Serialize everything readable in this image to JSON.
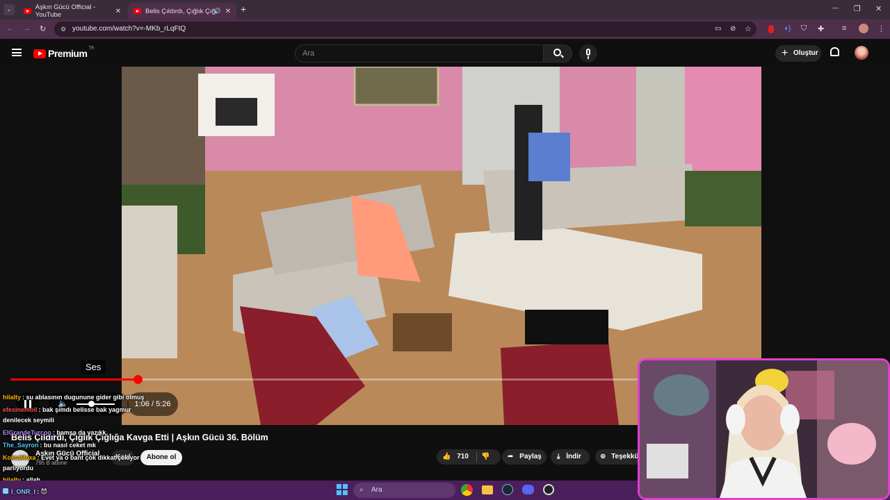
{
  "browser": {
    "tabs": [
      {
        "title": "Aşkın Gücü Official - YouTube",
        "close": "✕"
      },
      {
        "title": "Belis Çıldırdı, Çığlık Çığlığa K",
        "close": "✕"
      }
    ],
    "new_tab": "+",
    "window_controls": {
      "minimize": "—",
      "maximize": "❐",
      "close": "✕"
    },
    "url": "youtube.com/watch?v=-MKb_rLqFtQ"
  },
  "youtube": {
    "logo_text": "Premium",
    "logo_badge": "TR",
    "search_placeholder": "Ara",
    "create_label": "Oluştur"
  },
  "player": {
    "tooltip": "Ses",
    "time": "1:06 / 5:26",
    "progress": 0.203
  },
  "video_info": {
    "title": "Belis Çıldırdı, Çığlık Çığlığa Kavga Etti | Aşkın Gücü 36. Bölüm",
    "channel": "Aşkın Gücü Official",
    "subscribers": "795 B abone",
    "join_label": "Katıl",
    "subscribe_label": "Abone ol",
    "likes": "710",
    "share_label": "Paylaş",
    "download_label": "İndir",
    "thanks_label": "Teşekkür"
  },
  "chat": [
    {
      "user": "hilalty",
      "color": "#ffb300",
      "text": ": su ablasının dugunune gider gibi olmuş"
    },
    {
      "user": "efesinemoil",
      "color": "#ff4d4d",
      "text": ": bak şımdı belisse bak yagmur"
    },
    {
      "user": "",
      "color": "#ffffff",
      "text": "denilecek seymili"
    },
    {
      "user": "ElGrandeTurcoo",
      "color": "#b388ff",
      "text": ": bamsa da yazıkk"
    },
    {
      "user": "The_Sayron",
      "color": "#4fc3f7",
      "text": ": bu nasıl ceket mk"
    },
    {
      "user": "KomaMexa",
      "color": "#ffb300",
      "text": ": Evet ya o bant çok dikkat çekiyor"
    },
    {
      "user": "",
      "color": "#ffffff",
      "text": "parlıyordu"
    },
    {
      "user": "hilalty",
      "color": "#ffb300",
      "text": ": allah"
    },
    {
      "user": "I_ONR_I",
      "color": "#7fd1ff",
      "text": ": 😈"
    }
  ],
  "taskbar": {
    "search_placeholder": "Ara"
  },
  "colors": {
    "tab_strip": "#3a2d3a",
    "address_bar": "#4d2f4a",
    "youtube_red": "#ff0000",
    "cam_border": "#e040d0",
    "taskbar": "#4a1f5c"
  }
}
